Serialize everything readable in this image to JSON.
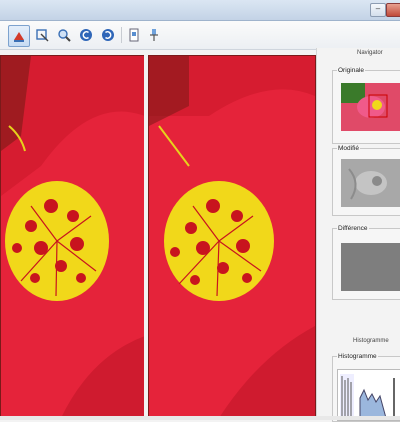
{
  "window": {
    "minimize_glyph": "–"
  },
  "toolbar": {
    "tools": [
      {
        "icon": "select-tool-icon",
        "active": true
      },
      {
        "icon": "crop-tool-icon"
      },
      {
        "icon": "zoom-tool-icon"
      },
      {
        "icon": "rotate-left-icon"
      },
      {
        "icon": "rotate-right-icon"
      },
      {
        "icon": "page-icon"
      },
      {
        "icon": "pin-icon"
      }
    ]
  },
  "panel": {
    "navigator_title": "Navigator",
    "original_label": "Originale",
    "modified_label": "Modifié",
    "difference_label": "Différence",
    "histogram_section_title": "Histogramme",
    "histogram_label": "Histogramme"
  },
  "colors": {
    "petal_red": "#e8243a",
    "petal_dark": "#b81222",
    "stamen_yellow": "#f0d81a",
    "stamen_red": "#c8141e",
    "gray_diff": "#7e7e7e"
  }
}
